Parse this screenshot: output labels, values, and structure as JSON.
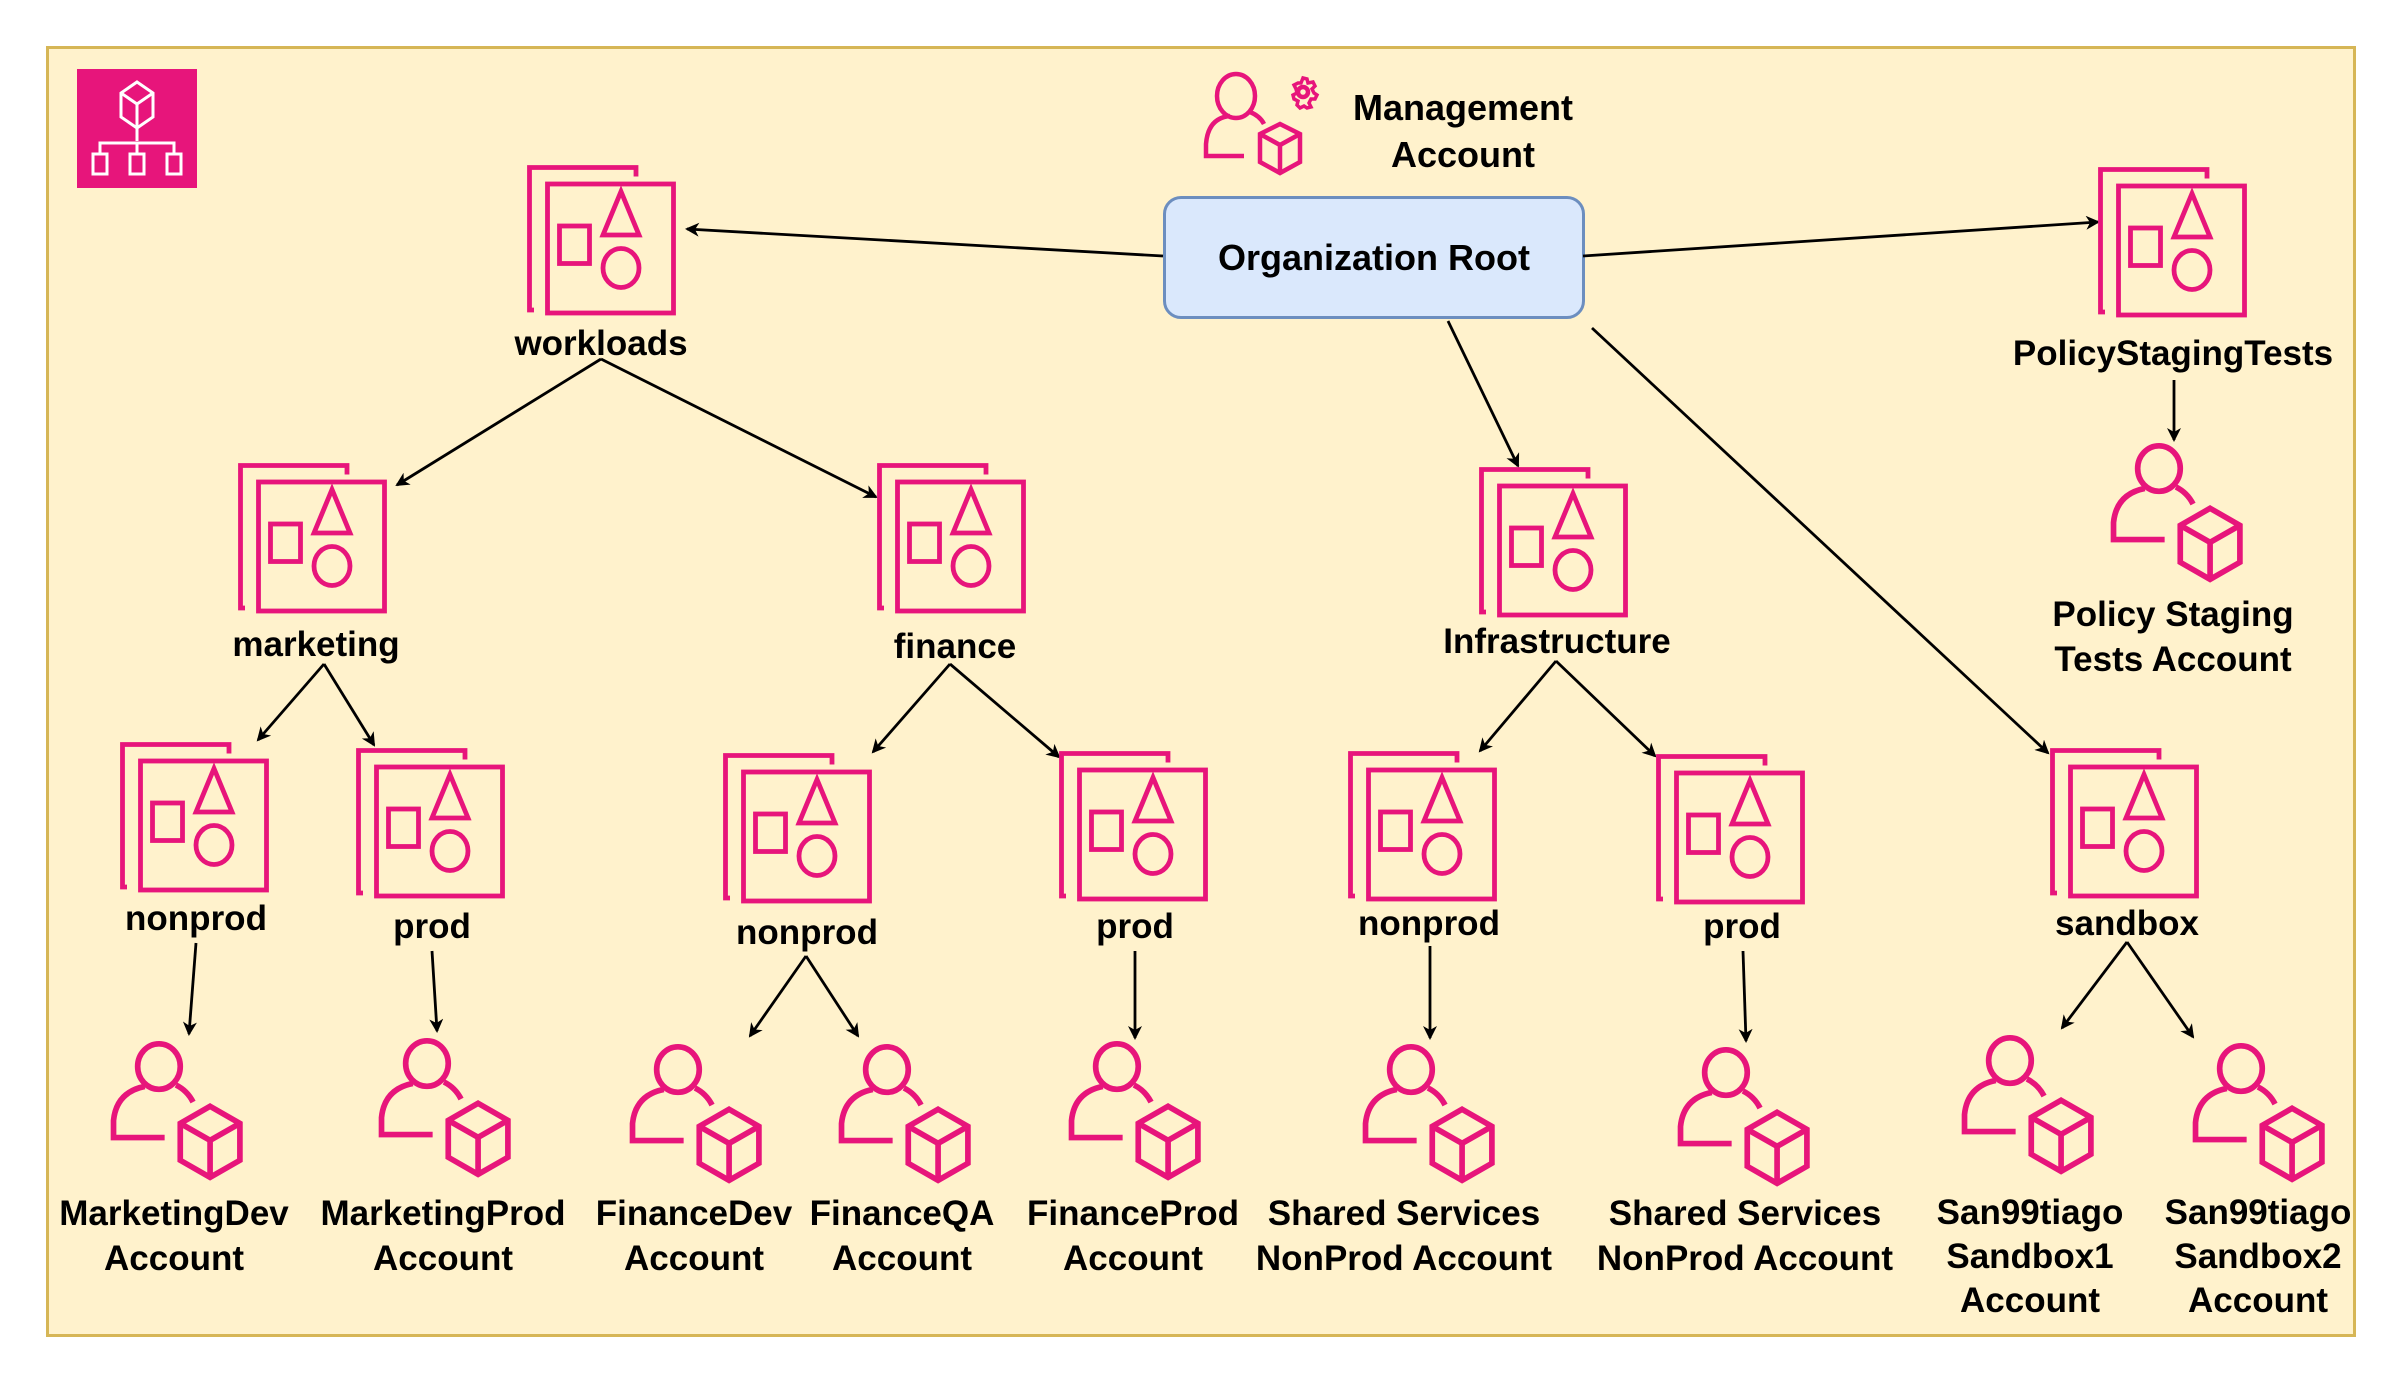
{
  "diagram": {
    "title": "AWS Organizations",
    "colors": {
      "pink": "#e7157b",
      "background": "#fff2cc",
      "frame_border": "#d6b656",
      "root_fill": "#dae8fc",
      "root_border": "#6c8ebf",
      "edge": "#000000"
    },
    "management_account": {
      "label_line1": "Management",
      "label_line2": "Account"
    },
    "root": {
      "label": "Organization Root"
    },
    "ous": {
      "workloads": "workloads",
      "policy_staging_tests": "PolicyStagingTests",
      "infrastructure": "Infrastructure",
      "sandbox": "sandbox",
      "marketing": "marketing",
      "finance": "finance",
      "marketing_nonprod": "nonprod",
      "marketing_prod": "prod",
      "finance_nonprod": "nonprod",
      "finance_prod": "prod",
      "infra_nonprod": "nonprod",
      "infra_prod": "prod"
    },
    "accounts": {
      "policy_staging": [
        "Policy Staging",
        "Tests Account"
      ],
      "marketing_dev": [
        "MarketingDev",
        "Account"
      ],
      "marketing_prod": [
        "MarketingProd",
        "Account"
      ],
      "finance_dev": [
        "FinanceDev",
        "Account"
      ],
      "finance_qa": [
        "FinanceQA",
        "Account"
      ],
      "finance_prod": [
        "FinanceProd",
        "Account"
      ],
      "shared_services_1": [
        "Shared Services",
        "NonProd Account"
      ],
      "shared_services_2": [
        "Shared Services",
        "NonProd Account"
      ],
      "sandbox1": [
        "San99tiago",
        "Sandbox1",
        "Account"
      ],
      "sandbox2": [
        "San99tiago",
        "Sandbox2",
        "Account"
      ]
    }
  }
}
